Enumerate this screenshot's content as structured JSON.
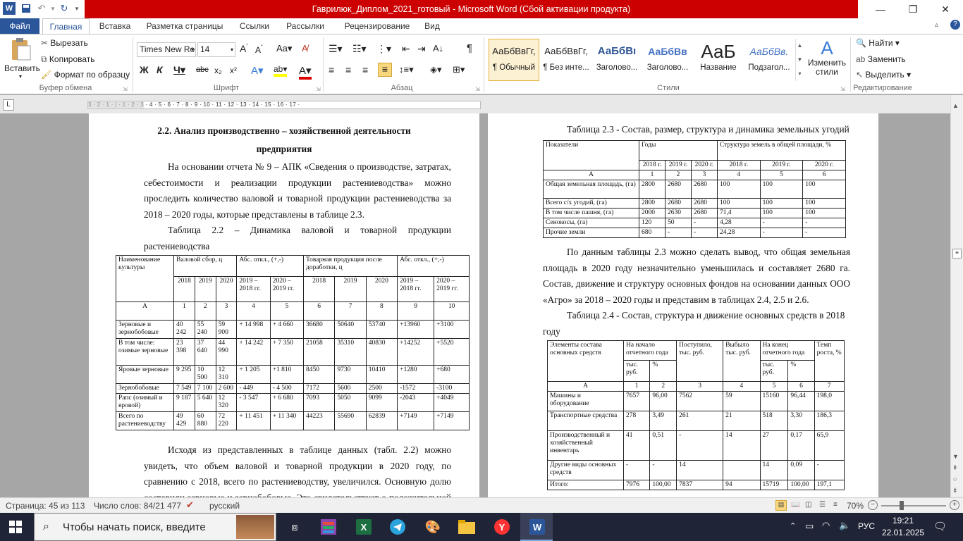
{
  "window": {
    "title": "Гаврилюк_Диплом_2021_готовый - Microsoft Word (Сбой активации продукта)"
  },
  "tabs": [
    "Файл",
    "Главная",
    "Вставка",
    "Разметка страницы",
    "Ссылки",
    "Рассылки",
    "Рецензирование",
    "Вид"
  ],
  "ribbon": {
    "clipboard": {
      "paste": "Вставить",
      "cut": "Вырезать",
      "copy": "Копировать",
      "format_painter": "Формат по образцу",
      "label": "Буфер обмена"
    },
    "font": {
      "name": "Times New Ro",
      "size": "14",
      "label": "Шрифт"
    },
    "paragraph": {
      "label": "Абзац"
    },
    "styles": {
      "label": "Стили",
      "items": [
        {
          "sample": "АаБбВвГг,",
          "name": "¶ Обычный"
        },
        {
          "sample": "АаБбВвГг,",
          "name": "¶ Без инте..."
        },
        {
          "sample": "АаБбВı",
          "name": "Заголово..."
        },
        {
          "sample": "АаБбВв",
          "name": "Заголово..."
        },
        {
          "sample": "АаБ",
          "name": "Название"
        },
        {
          "sample": "АаБбВв.",
          "name": "Подзагол..."
        }
      ],
      "change": "Изменить стили"
    },
    "editing": {
      "find": "Найти",
      "replace": "Заменить",
      "select": "Выделить",
      "label": "Редактирование"
    }
  },
  "ruler": {
    "marks": "3 · 2 · 1 · | · 1 · 2 · 3 · 4 · 5 · 6 · 7 · 8 · 9 · 10 · 11 · 12 · 13 · 14 · 15 · 16 · 17 ·"
  },
  "left_page": {
    "heading1": "2.2. Анализ производственно – хозяйственной деятельности",
    "heading2": "предприятия",
    "para1": "На основании отчета № 9 – АПК «Сведения о производстве, затратах, себестоимости и реализации продукции растениеводства» можно проследить количество валовой и товарной продукции растениеводства за 2018 – 2020 годы, которые представлены в таблице 2.3.",
    "caption": "Таблица 2.2 – Динамика валовой и товарной продукции растениеводства",
    "table": {
      "h1": [
        "Наименование культуры",
        "Валовой сбор, ц",
        "Абс. откл., (+,-)",
        "Товарная продукция после доработки, ц",
        "Абс. откл., (+,-)"
      ],
      "h2": [
        "2018",
        "2019",
        "2020",
        "2019 – 2018 гг.",
        "2020 – 2019 гг.",
        "2018",
        "2019",
        "2020",
        "2019 – 2018 гг.",
        "2020 – 2019 гг."
      ],
      "nums": [
        "А",
        "1",
        "2",
        "3",
        "4",
        "5",
        "6",
        "7",
        "8",
        "9",
        "10"
      ],
      "rows": [
        [
          "Зерновые и зернобобовые",
          "40 242",
          "55 240",
          "59 900",
          "+ 14 998",
          "+ 4 660",
          "36680",
          "50640",
          "53740",
          "+13960",
          "+3100"
        ],
        [
          "В том числе: озимые зерновые",
          "23 398",
          "37 640",
          "44 990",
          "+ 14 242",
          "+ 7 350",
          "21058",
          "35310",
          "40830",
          "+14252",
          "+5520"
        ],
        [
          "Яровые зерновые",
          "9 295",
          "10 500",
          "12 310",
          "+ 1 205",
          "+1 810",
          "8450",
          "9730",
          "10410",
          "+1280",
          "+680"
        ],
        [
          "Зернобобовые",
          "7 549",
          "7 100",
          "2 600",
          "- 449",
          "- 4 500",
          "7172",
          "5600",
          "2500",
          "-1572",
          "-3100"
        ],
        [
          "Рапс (озимый и яровой)",
          "9 187",
          "5 640",
          "12 320",
          "- 3 547",
          "+ 6 680",
          "7093",
          "5050",
          "9099",
          "-2043",
          "+4049"
        ],
        [
          "Всего по растениеводству",
          "49 429",
          "60 880",
          "72 220",
          "+ 11 451",
          "+ 11 340",
          "44223",
          "55690",
          "62839",
          "+7149",
          "+7149"
        ]
      ]
    },
    "para2": "Исходя из представленных в таблице данных (табл. 2.2) можно увидеть, что объем валовой и товарной продукции в 2020 году, по сравнению с 2018, всего по растениеводству, увеличился. Основную долю составили зерновые и зернобобовые. Это свидетельствует о положительной динамике развития"
  },
  "right_page": {
    "caption1": "Таблица 2.3 - Состав, размер, структура и динамика земельных угодий",
    "table1": {
      "h1": [
        "Показатели",
        "Годы",
        "Структура земель в общей площади, %"
      ],
      "h2": [
        "2018 г.",
        "2019 г.",
        "2020 г.",
        "2018 г.",
        "2019 г.",
        "2020 г."
      ],
      "nums": [
        "А",
        "1",
        "2",
        "3",
        "4",
        "5",
        "6"
      ],
      "rows": [
        [
          "Общая земельная площадь, (га)",
          "2800",
          "2680",
          "2680",
          "100",
          "100",
          "100"
        ],
        [
          "Всего с/х угодий, (га)",
          "2800",
          "2680",
          "2680",
          "100",
          "100",
          "100"
        ],
        [
          "В том числе пашня, (га)",
          "2000",
          "2630",
          "2680",
          "71,4",
          "100",
          "100"
        ],
        [
          "Сенокосы, (га)",
          "120",
          "50",
          "-",
          "4,28",
          "-",
          "-"
        ],
        [
          "Прочие земли",
          "680",
          "-",
          "-",
          "24,28",
          "-",
          "-"
        ]
      ]
    },
    "para1": "По данным таблицы 2.3 можно сделать вывод, что общая земельная площадь в 2020 году незначительно уменьшилась и составляет 2680 га. Состав, движение и структуру основных фондов на основании данных ООО «Агро» за 2018 – 2020 годы и представим в таблицах 2.4, 2.5 и 2.6.",
    "caption2": "Таблица 2.4 - Состав, структура и движение основных средств в 2018 году",
    "table2": {
      "h1": [
        "Элементы состава основных средств",
        "На начало отчетного года",
        "Поступило, тыс. руб.",
        "Выбыло тыс. руб.",
        "На конец отчетного года",
        "Темп роста, %"
      ],
      "h2": [
        "тыс. руб.",
        "%",
        "тыс. руб.",
        "%"
      ],
      "nums": [
        "А",
        "1",
        "2",
        "3",
        "4",
        "5",
        "6",
        "7"
      ],
      "rows": [
        [
          "Машины и оборудование",
          "7657",
          "96,00",
          "7562",
          "59",
          "15160",
          "96,44",
          "198,0"
        ],
        [
          "Транспортные средства",
          "278",
          "3,49",
          "261",
          "21",
          "518",
          "3,30",
          "186,3"
        ],
        [
          "Производственный и хозяйственный инвентарь",
          "41",
          "0,51",
          "-",
          "14",
          "27",
          "0,17",
          "65,9"
        ],
        [
          "Другие виды основных средств",
          "-",
          "-",
          "14",
          "",
          "14",
          "0,09",
          "-"
        ],
        [
          "Итого:",
          "7976",
          "100,00",
          "7837",
          "94",
          "15719",
          "100,00",
          "197,1"
        ]
      ]
    }
  },
  "status": {
    "page": "Страница: 45 из 113",
    "words": "Число слов: 84/21 477",
    "lang": "русский",
    "zoom": "70%"
  },
  "taskbar": {
    "search": "Чтобы начать поиск, введите",
    "lang": "РУС",
    "time": "19:21",
    "date": "22.01.2025"
  }
}
